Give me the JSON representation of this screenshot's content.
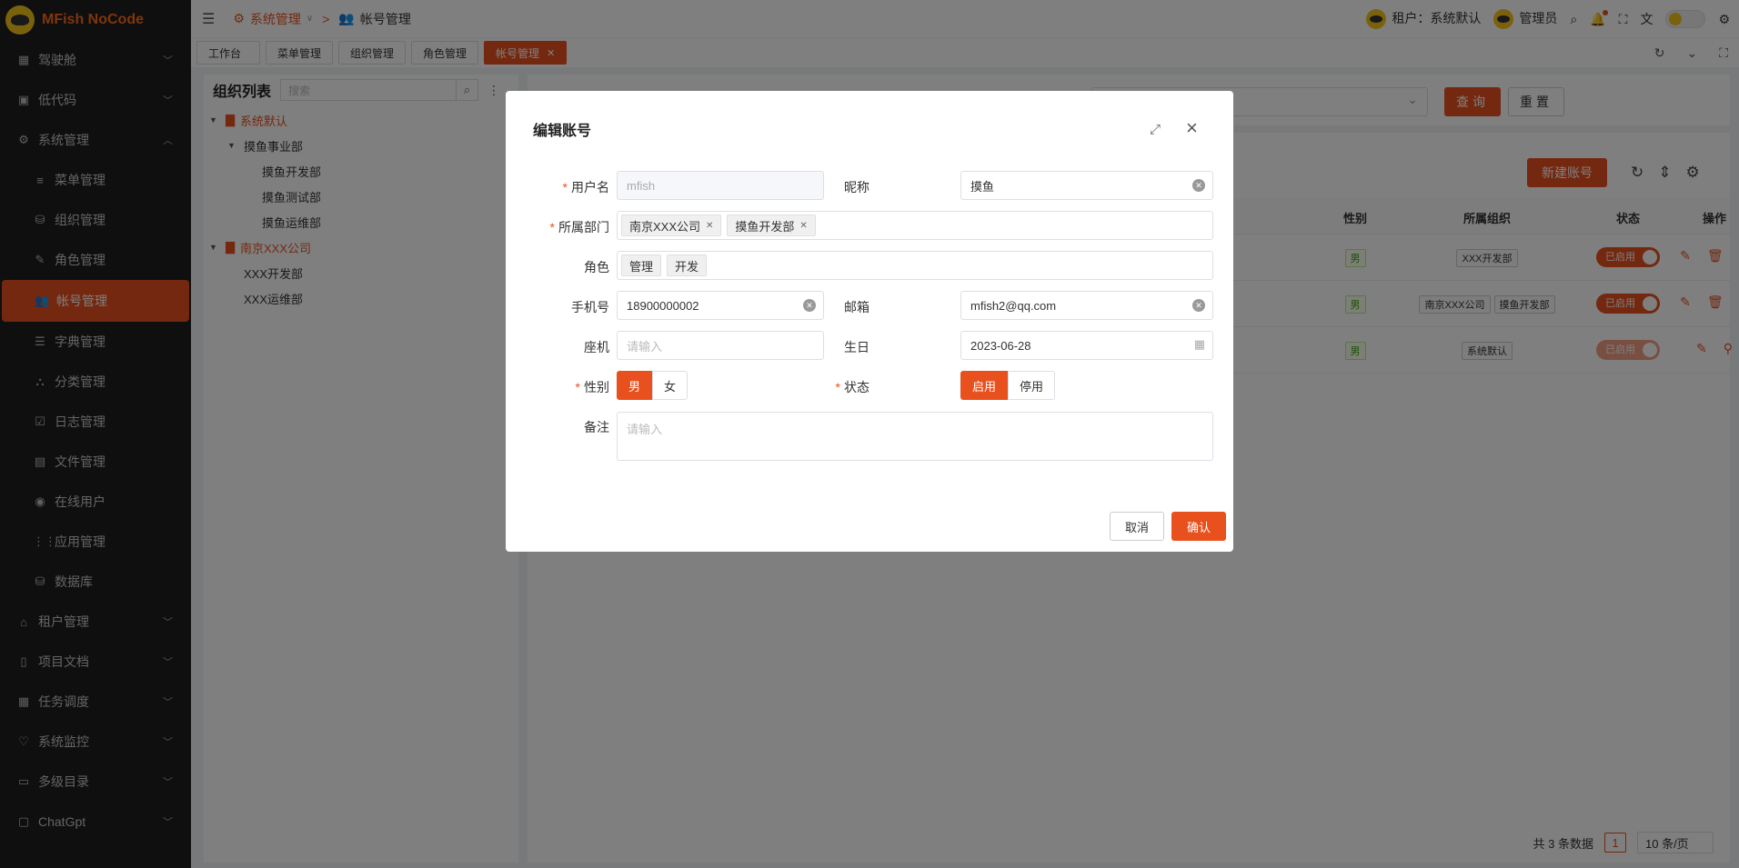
{
  "app": {
    "name": "MFish NoCode"
  },
  "sidebar": {
    "items": [
      {
        "label": "驾驶舱",
        "icon": "dashboard-icon",
        "expandable": true
      },
      {
        "label": "低代码",
        "icon": "code-icon",
        "expandable": true
      },
      {
        "label": "系统管理",
        "icon": "gear-icon",
        "expandable": true,
        "expanded": true
      },
      {
        "label": "菜单管理",
        "icon": "menu-icon",
        "sub": true
      },
      {
        "label": "组织管理",
        "icon": "org-icon",
        "sub": true
      },
      {
        "label": "角色管理",
        "icon": "role-icon",
        "sub": true
      },
      {
        "label": "帐号管理",
        "icon": "users-icon",
        "sub": true,
        "active": true
      },
      {
        "label": "字典管理",
        "icon": "list-icon",
        "sub": true
      },
      {
        "label": "分类管理",
        "icon": "category-icon",
        "sub": true
      },
      {
        "label": "日志管理",
        "icon": "log-icon",
        "sub": true
      },
      {
        "label": "文件管理",
        "icon": "file-icon",
        "sub": true
      },
      {
        "label": "在线用户",
        "icon": "wifi-icon",
        "sub": true
      },
      {
        "label": "应用管理",
        "icon": "apps-icon",
        "sub": true
      },
      {
        "label": "数据库",
        "icon": "database-icon",
        "sub": true
      },
      {
        "label": "租户管理",
        "icon": "home-icon",
        "expandable": true
      },
      {
        "label": "项目文档",
        "icon": "book-icon",
        "expandable": true
      },
      {
        "label": "任务调度",
        "icon": "calendar-icon",
        "expandable": true
      },
      {
        "label": "系统监控",
        "icon": "heart-icon",
        "expandable": true
      },
      {
        "label": "多级目录",
        "icon": "folder-icon",
        "expandable": true
      },
      {
        "label": "ChatGpt",
        "icon": "chat-icon",
        "expandable": true
      }
    ]
  },
  "header": {
    "breadcrumb": {
      "parent": "系统管理",
      "current": "帐号管理"
    },
    "tenant": "租户：系统默认",
    "user": "管理员"
  },
  "tabs": [
    {
      "label": "工作台"
    },
    {
      "label": "菜单管理"
    },
    {
      "label": "组织管理"
    },
    {
      "label": "角色管理"
    },
    {
      "label": "帐号管理",
      "active": true
    }
  ],
  "org": {
    "title": "组织列表",
    "search_placeholder": "搜索",
    "tree": [
      {
        "label": "系统默认",
        "level": 0,
        "root": true,
        "caret": "▼"
      },
      {
        "label": "摸鱼事业部",
        "level": 1,
        "caret": "▼"
      },
      {
        "label": "摸鱼开发部",
        "level": 2
      },
      {
        "label": "摸鱼测试部",
        "level": 2
      },
      {
        "label": "摸鱼运维部",
        "level": 2
      },
      {
        "label": "南京XXX公司",
        "level": 0,
        "root": true,
        "caret": "▼"
      },
      {
        "label": "XXX开发部",
        "level": 1
      },
      {
        "label": "XXX运维部",
        "level": 1
      }
    ]
  },
  "list": {
    "query_label": "查询",
    "reset_label": "重置",
    "new_label": "新建账号",
    "columns": {
      "gender": "性别",
      "org": "所属组织",
      "status": "状态",
      "op": "操作"
    },
    "rows": [
      {
        "gender": "男",
        "orgs": [
          "XXX开发部"
        ],
        "status": "已启用",
        "dim": false,
        "ops": [
          "edit",
          "delete",
          "search"
        ]
      },
      {
        "gender": "男",
        "orgs": [
          "南京XXX公司",
          "摸鱼开发部"
        ],
        "status": "已启用",
        "dim": false,
        "ops": [
          "edit",
          "delete",
          "search"
        ]
      },
      {
        "gender": "男",
        "orgs": [
          "系统默认"
        ],
        "status": "已启用",
        "dim": true,
        "ops": [
          "edit",
          "search"
        ]
      }
    ],
    "total_text": "共 3 条数据",
    "page": "1",
    "page_size": "10 条/页"
  },
  "modal": {
    "title": "编辑账号",
    "fields": {
      "username": {
        "label": "用户名",
        "value": "mfish"
      },
      "nickname": {
        "label": "昵称",
        "value": "摸鱼"
      },
      "dept": {
        "label": "所属部门",
        "values": [
          "南京XXX公司",
          "摸鱼开发部"
        ]
      },
      "role": {
        "label": "角色",
        "values": [
          "管理",
          "开发"
        ]
      },
      "phone": {
        "label": "手机号",
        "value": "18900000002"
      },
      "email": {
        "label": "邮箱",
        "value": "mfish2@qq.com"
      },
      "landline": {
        "label": "座机",
        "placeholder": "请输入"
      },
      "birthday": {
        "label": "生日",
        "value": "2023-06-28"
      },
      "gender": {
        "label": "性别",
        "options": [
          "男",
          "女"
        ],
        "selected": "男"
      },
      "status": {
        "label": "状态",
        "options": [
          "启用",
          "停用"
        ],
        "selected": "启用"
      },
      "remark": {
        "label": "备注",
        "placeholder": "请输入"
      }
    },
    "cancel_label": "取消",
    "ok_label": "确认"
  },
  "colors": {
    "accent": "#e8501e",
    "sidebar_bg": "#1f1f1f"
  }
}
